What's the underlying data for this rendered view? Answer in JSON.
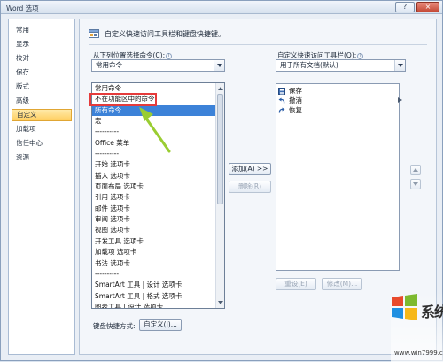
{
  "window": {
    "title": "Word 选项",
    "help_label": "?",
    "close_label": "×"
  },
  "sidebar": {
    "items": [
      {
        "label": "常用"
      },
      {
        "label": "显示"
      },
      {
        "label": "校对"
      },
      {
        "label": "保存"
      },
      {
        "label": "版式"
      },
      {
        "label": "高级"
      },
      {
        "label": "自定义"
      },
      {
        "label": "加载项"
      },
      {
        "label": "信任中心"
      },
      {
        "label": "资源"
      }
    ],
    "active_index": 6
  },
  "main": {
    "header": "自定义快速访问工具栏和键盘快捷键。",
    "choose_label": "从下列位置选择命令(C):",
    "choose_value": "常用命令",
    "customize_label": "自定义快速访问工具栏(Q):",
    "customize_value": "用于所有文档(默认)",
    "dropdown_items": [
      "常用命令",
      "不在功能区中的命令",
      "所有命令",
      "宏",
      "----------",
      "Office 菜单",
      "----------",
      "开始 选项卡",
      "插入 选项卡",
      "页面布局 选项卡",
      "引用 选项卡",
      "邮件 选项卡",
      "审阅 选项卡",
      "视图 选项卡",
      "开发工具 选项卡",
      "加载项 选项卡",
      "书法 选项卡",
      "----------",
      "SmartArt 工具 | 设计 选项卡",
      "SmartArt 工具 | 格式 选项卡",
      "图表工具 | 设计 选项卡"
    ],
    "selected_index": 2,
    "add_label": "添加(A) >>",
    "remove_label": "删除(R)",
    "toolbar_items": [
      {
        "label": "保存",
        "icon": "save-icon"
      },
      {
        "label": "撤消",
        "icon": "undo-icon"
      },
      {
        "label": "恢复",
        "icon": "redo-icon"
      }
    ],
    "reset_label": "重设(E)",
    "modify_label": "修改(M)...",
    "keyboard_label": "键盘快捷方式:",
    "keyboard_button": "自定义(I)..."
  },
  "watermark": {
    "text": "系统粉",
    "site": "www.win7999.com"
  },
  "colors": {
    "selection": "#3c82d8",
    "highlight_box": "#e53b3b",
    "annotation_arrow": "#9acd32",
    "sidebar_active": "#ffcf62"
  }
}
